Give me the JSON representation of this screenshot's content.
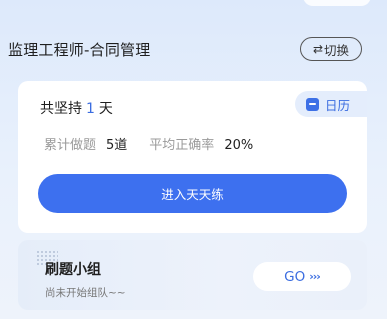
{
  "header": {
    "title": "监理工程师-合同管理",
    "switch_label": "切换",
    "switch_icon": "⇄"
  },
  "progress": {
    "prefix": "共坚持",
    "days": "1",
    "suffix": "天",
    "calendar_label": "日历"
  },
  "stats": {
    "total_label": "累计做题",
    "total_value": "5道",
    "accuracy_label": "平均正确率",
    "accuracy_value": "20%"
  },
  "daily_practice": {
    "button_label": "进入天天练"
  },
  "group": {
    "title": "刷题小组",
    "subtitle": "尚未开始组队~~",
    "go_label": "GO",
    "go_arrows": "›››"
  },
  "colors": {
    "accent": "#3d70ef",
    "calendar_bg": "#e4edfc"
  }
}
